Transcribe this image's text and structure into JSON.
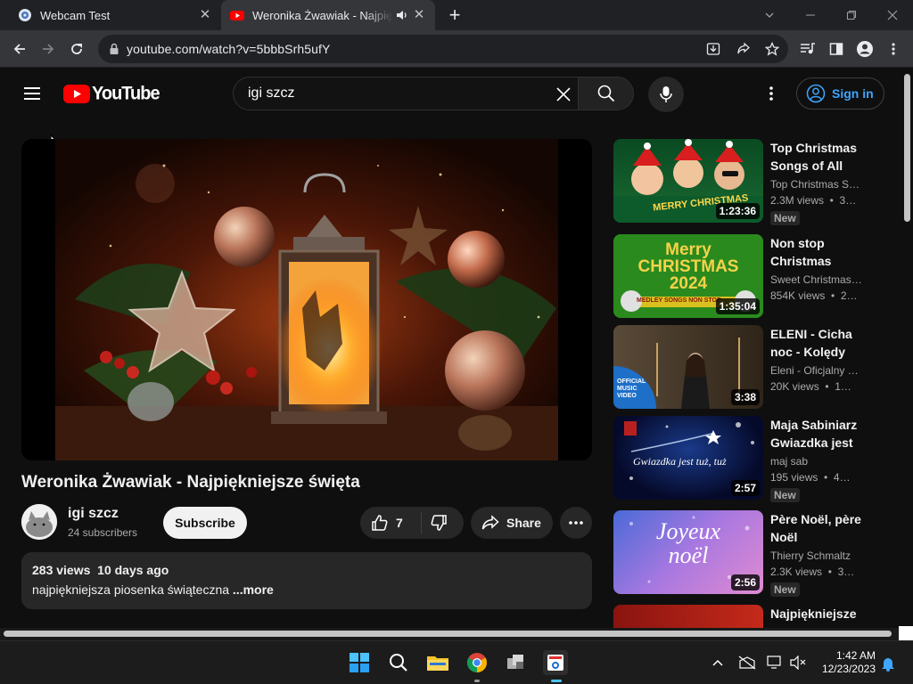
{
  "browser": {
    "tabs": [
      {
        "title": "Webcam Test"
      },
      {
        "title": "Weronika Żwawiak - Najpięk"
      }
    ],
    "new_tab_label": "+",
    "url": "youtube.com/watch?v=5bbbSrh5ufY"
  },
  "header": {
    "logo_text": "YouTube",
    "search_value": "igi szcz",
    "sign_in_label": "Sign in"
  },
  "video": {
    "title": "Weronika Żwawiak - Najpiękniejsze święta",
    "channel": "igi szcz",
    "subscribers": "24 subscribers",
    "subscribe_label": "Subscribe",
    "likes": "7",
    "share_label": "Share",
    "description": {
      "stats": "283 views  10 days ago",
      "text": "najpiękniejsza piosenka świąteczna ",
      "more_label": "...more"
    }
  },
  "recommendations": [
    {
      "title": "Top Christmas Songs of All Time",
      "channel": "Top Christmas Songs",
      "meta": "2.3M views  •  3…",
      "duration": "1:23:36",
      "badge": "New",
      "thumb_text": "MERRY CHRISTMAS"
    },
    {
      "title": "Non stop Christmas Medley",
      "channel": "Sweet Christmas Songs",
      "meta": "854K views  •  2…",
      "duration": "1:35:04",
      "badge": "",
      "thumb_text": "Merry CHRISTMAS 2024",
      "thumb_sub": "MEDLEY SONGS NON STOP"
    },
    {
      "title": "ELENI - Cicha noc - Kolędy",
      "channel": "Eleni - Oficjalny Kanał",
      "meta": "20K views  •  1…",
      "duration": "3:38",
      "badge": "",
      "thumb_text": "OFFICIAL MUSIC VIDEO"
    },
    {
      "title": "Maja Sabiniarz Gwiazdka jest tuż",
      "channel": "maj sab",
      "meta": "195 views  •  4…",
      "duration": "2:57",
      "badge": "New",
      "thumb_text": "Gwiazdka jest tuż, tuż"
    },
    {
      "title": "Père Noël, père Noël",
      "channel": "Thierry Schmaltz",
      "meta": "2.3K views  •  3…",
      "duration": "2:56",
      "badge": "New",
      "thumb_text": "Joyeux noël"
    },
    {
      "title": "Najpiękniejsze",
      "channel": "",
      "meta": "",
      "duration": "",
      "badge": "",
      "thumb_text": ""
    }
  ],
  "taskbar": {
    "time": "1:42 AM",
    "date": "12/23/2023"
  },
  "colors": {
    "yt_red": "#ff0000",
    "link_blue": "#3ea6ff",
    "background": "#0f0f0f"
  }
}
